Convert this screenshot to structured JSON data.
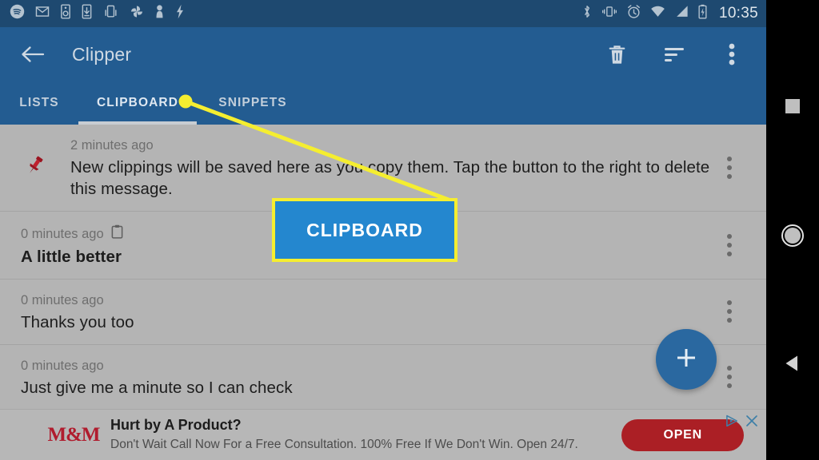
{
  "status_bar": {
    "time": "10:35",
    "left_icons": [
      "spotify-icon",
      "gmail-icon",
      "speaker-icon",
      "download-icon",
      "cast-screen-icon",
      "pinwheel-icon",
      "person-icon",
      "flash-icon"
    ],
    "right_icons": [
      "bluetooth-icon",
      "vibrate-icon",
      "alarm-icon",
      "wifi-icon",
      "cell-signal-icon",
      "battery-charging-icon"
    ]
  },
  "app_bar": {
    "title": "Clipper",
    "back_icon": "back-arrow-icon",
    "actions": [
      {
        "name": "delete-icon",
        "label": "Delete"
      },
      {
        "name": "sort-icon",
        "label": "Sort"
      },
      {
        "name": "overflow-menu-icon",
        "label": "More options"
      }
    ]
  },
  "tabs": {
    "items": [
      {
        "label": "LISTS",
        "active": false
      },
      {
        "label": "CLIPBOARD",
        "active": true
      },
      {
        "label": "SNIPPETS",
        "active": false
      }
    ]
  },
  "list": {
    "rows": [
      {
        "time": "2 minutes ago",
        "text": "New clippings will be saved here as you copy them. Tap the button to the right to delete this message.",
        "lead_icon": "pushpin-icon",
        "time_icon": null,
        "bold": false
      },
      {
        "time": "0 minutes ago",
        "text": "A little better",
        "lead_icon": null,
        "time_icon": "clipboard-icon",
        "bold": true
      },
      {
        "time": "0 minutes ago",
        "text": "Thanks you too",
        "lead_icon": null,
        "time_icon": null,
        "bold": false
      },
      {
        "time": "0 minutes ago",
        "text": "Just give me a minute so I can check",
        "lead_icon": null,
        "time_icon": null,
        "bold": false
      }
    ]
  },
  "fab": {
    "icon": "plus-icon",
    "label": "Add"
  },
  "ad": {
    "logo_text": "M&M",
    "title": "Hurt by A Product?",
    "subtitle": "Don't Wait Call Now For a Free Consultation. 100% Free If We Don't Win. Open 24/7.",
    "cta_label": "OPEN",
    "adchoices_icon": "adchoices-icon",
    "close_icon": "close-icon"
  },
  "nav_bar": {
    "recents_icon": "square-recents-icon",
    "home_icon": "circle-home-icon",
    "back_icon": "triangle-back-icon"
  },
  "annotation": {
    "callout_label": "CLIPBOARD",
    "box_color": "#2487cf",
    "border_color": "#f5ee30",
    "pointer_color": "#f5ee30"
  },
  "colors": {
    "status_bar": "#1e4970",
    "app_bar": "#235c91",
    "background": "#b4b4b4",
    "fab": "#2a68a0",
    "ad_cta": "#ab1f25",
    "logo_red": "#b01c2e"
  }
}
